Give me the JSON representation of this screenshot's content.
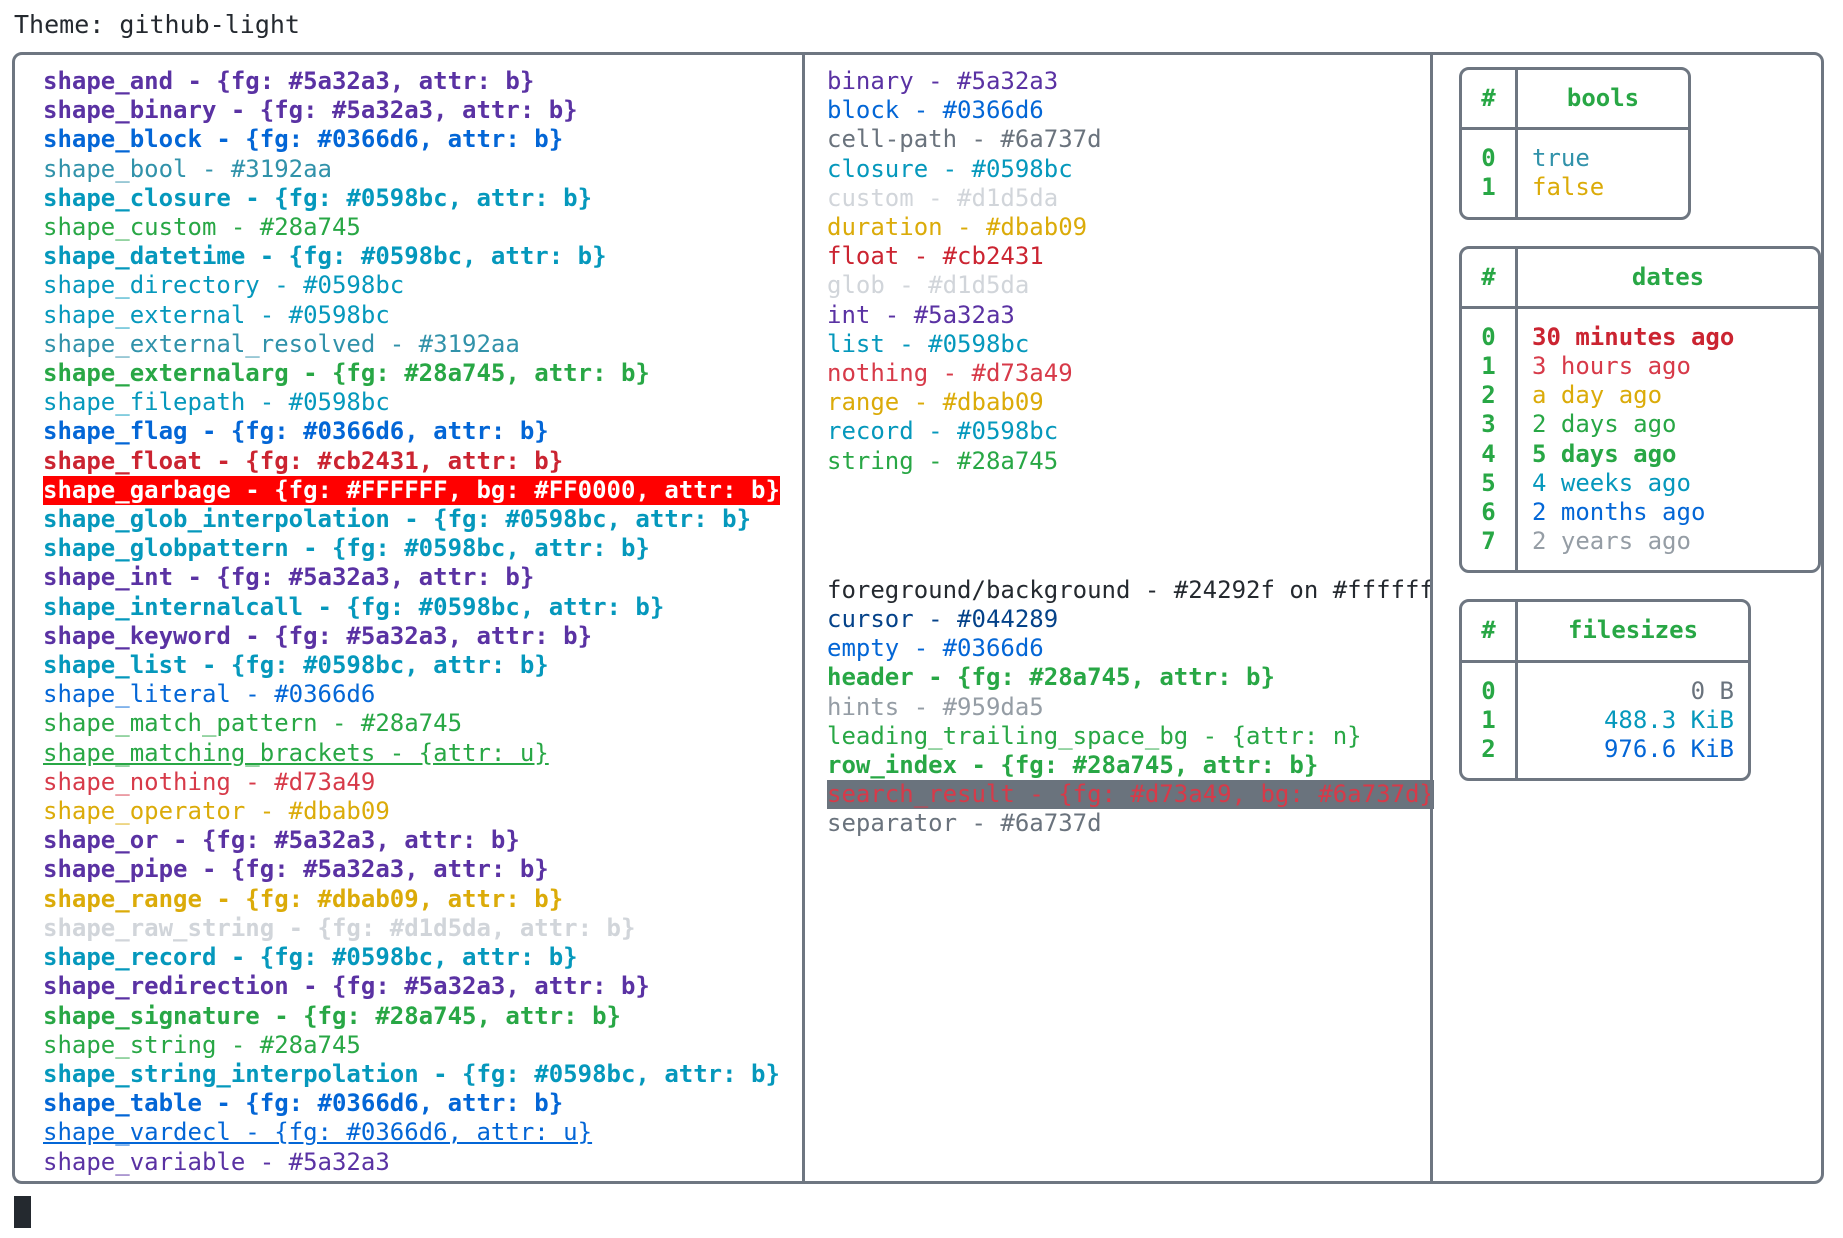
{
  "header": {
    "theme_label": "Theme: github-light"
  },
  "colors": {
    "purple": "#5a32a3",
    "blue": "#0366d6",
    "teal_dark": "#3192aa",
    "cyan": "#0598bc",
    "green": "#28a745",
    "red": "#cb2431",
    "red_alt": "#d73a49",
    "gold": "#dbab09",
    "gray": "#6a737d",
    "gray_light": "#d1d5da",
    "gray_hint": "#959da5",
    "frame": "#6e7681",
    "fg": "#24292f",
    "bg": "#ffffff",
    "garbage_bg": "#FF0000",
    "garbage_fg": "#FFFFFF"
  },
  "shapes": [
    {
      "text": "shape_and - {fg: #5a32a3, attr: b}",
      "color": "#5a32a3",
      "bold": true,
      "underline": false
    },
    {
      "text": "shape_binary - {fg: #5a32a3, attr: b}",
      "color": "#5a32a3",
      "bold": true,
      "underline": false
    },
    {
      "text": "shape_block - {fg: #0366d6, attr: b}",
      "color": "#0366d6",
      "bold": true,
      "underline": false
    },
    {
      "text": "shape_bool - #3192aa",
      "color": "#3192aa",
      "bold": false,
      "underline": false
    },
    {
      "text": "shape_closure - {fg: #0598bc, attr: b}",
      "color": "#0598bc",
      "bold": true,
      "underline": false
    },
    {
      "text": "shape_custom - #28a745",
      "color": "#28a745",
      "bold": false,
      "underline": false
    },
    {
      "text": "shape_datetime - {fg: #0598bc, attr: b}",
      "color": "#0598bc",
      "bold": true,
      "underline": false
    },
    {
      "text": "shape_directory - #0598bc",
      "color": "#0598bc",
      "bold": false,
      "underline": false
    },
    {
      "text": "shape_external - #0598bc",
      "color": "#0598bc",
      "bold": false,
      "underline": false
    },
    {
      "text": "shape_external_resolved - #3192aa",
      "color": "#3192aa",
      "bold": false,
      "underline": false
    },
    {
      "text": "shape_externalarg - {fg: #28a745, attr: b}",
      "color": "#28a745",
      "bold": true,
      "underline": false
    },
    {
      "text": "shape_filepath - #0598bc",
      "color": "#0598bc",
      "bold": false,
      "underline": false
    },
    {
      "text": "shape_flag - {fg: #0366d6, attr: b}",
      "color": "#0366d6",
      "bold": true,
      "underline": false
    },
    {
      "text": "shape_float - {fg: #cb2431, attr: b}",
      "color": "#cb2431",
      "bold": true,
      "underline": false
    },
    {
      "text": "shape_garbage - {fg: #FFFFFF, bg: #FF0000, attr: b}",
      "color": "#FFFFFF",
      "bg": "#FF0000",
      "bold": true,
      "underline": false
    },
    {
      "text": "shape_glob_interpolation - {fg: #0598bc, attr: b}",
      "color": "#0598bc",
      "bold": true,
      "underline": false
    },
    {
      "text": "shape_globpattern - {fg: #0598bc, attr: b}",
      "color": "#0598bc",
      "bold": true,
      "underline": false
    },
    {
      "text": "shape_int - {fg: #5a32a3, attr: b}",
      "color": "#5a32a3",
      "bold": true,
      "underline": false
    },
    {
      "text": "shape_internalcall - {fg: #0598bc, attr: b}",
      "color": "#0598bc",
      "bold": true,
      "underline": false
    },
    {
      "text": "shape_keyword - {fg: #5a32a3, attr: b}",
      "color": "#5a32a3",
      "bold": true,
      "underline": false
    },
    {
      "text": "shape_list - {fg: #0598bc, attr: b}",
      "color": "#0598bc",
      "bold": true,
      "underline": false
    },
    {
      "text": "shape_literal - #0366d6",
      "color": "#0366d6",
      "bold": false,
      "underline": false
    },
    {
      "text": "shape_match_pattern - #28a745",
      "color": "#28a745",
      "bold": false,
      "underline": false
    },
    {
      "text": "shape_matching_brackets - {attr: u}",
      "color": "#28a745",
      "bold": false,
      "underline": true
    },
    {
      "text": "shape_nothing - #d73a49",
      "color": "#d73a49",
      "bold": false,
      "underline": false
    },
    {
      "text": "shape_operator - #dbab09",
      "color": "#dbab09",
      "bold": false,
      "underline": false
    },
    {
      "text": "shape_or - {fg: #5a32a3, attr: b}",
      "color": "#5a32a3",
      "bold": true,
      "underline": false
    },
    {
      "text": "shape_pipe - {fg: #5a32a3, attr: b}",
      "color": "#5a32a3",
      "bold": true,
      "underline": false
    },
    {
      "text": "shape_range - {fg: #dbab09, attr: b}",
      "color": "#dbab09",
      "bold": true,
      "underline": false
    },
    {
      "text": "shape_raw_string - {fg: #d1d5da, attr: b}",
      "color": "#d1d5da",
      "bold": true,
      "underline": false
    },
    {
      "text": "shape_record - {fg: #0598bc, attr: b}",
      "color": "#0598bc",
      "bold": true,
      "underline": false
    },
    {
      "text": "shape_redirection - {fg: #5a32a3, attr: b}",
      "color": "#5a32a3",
      "bold": true,
      "underline": false
    },
    {
      "text": "shape_signature - {fg: #28a745, attr: b}",
      "color": "#28a745",
      "bold": true,
      "underline": false
    },
    {
      "text": "shape_string - #28a745",
      "color": "#28a745",
      "bold": false,
      "underline": false
    },
    {
      "text": "shape_string_interpolation - {fg: #0598bc, attr: b}",
      "color": "#0598bc",
      "bold": true,
      "underline": false
    },
    {
      "text": "shape_table - {fg: #0366d6, attr: b}",
      "color": "#0366d6",
      "bold": true,
      "underline": false
    },
    {
      "text": "shape_vardecl - {fg: #0366d6, attr: u}",
      "color": "#0366d6",
      "bold": false,
      "underline": true
    },
    {
      "text": "shape_variable - #5a32a3",
      "color": "#5a32a3",
      "bold": false,
      "underline": false
    }
  ],
  "types": [
    {
      "text": "binary - #5a32a3",
      "color": "#5a32a3",
      "bold": false,
      "underline": false
    },
    {
      "text": "block - #0366d6",
      "color": "#0366d6",
      "bold": false,
      "underline": false
    },
    {
      "text": "cell-path - #6a737d",
      "color": "#6a737d",
      "bold": false,
      "underline": false
    },
    {
      "text": "closure - #0598bc",
      "color": "#0598bc",
      "bold": false,
      "underline": false
    },
    {
      "text": "custom - #d1d5da",
      "color": "#d1d5da",
      "bold": false,
      "underline": false
    },
    {
      "text": "duration - #dbab09",
      "color": "#dbab09",
      "bold": false,
      "underline": false
    },
    {
      "text": "float - #cb2431",
      "color": "#cb2431",
      "bold": false,
      "underline": false
    },
    {
      "text": "glob - #d1d5da",
      "color": "#d1d5da",
      "bold": false,
      "underline": false
    },
    {
      "text": "int - #5a32a3",
      "color": "#5a32a3",
      "bold": false,
      "underline": false
    },
    {
      "text": "list - #0598bc",
      "color": "#0598bc",
      "bold": false,
      "underline": false
    },
    {
      "text": "nothing - #d73a49",
      "color": "#d73a49",
      "bold": false,
      "underline": false
    },
    {
      "text": "range - #dbab09",
      "color": "#dbab09",
      "bold": false,
      "underline": false
    },
    {
      "text": "record - #0598bc",
      "color": "#0598bc",
      "bold": false,
      "underline": false
    },
    {
      "text": "string - #28a745",
      "color": "#28a745",
      "bold": false,
      "underline": false
    }
  ],
  "ui_elements": [
    {
      "text": "foreground/background - #24292f on #ffffff",
      "color": "#24292f",
      "bold": false,
      "underline": false
    },
    {
      "text": "cursor - #044289",
      "color": "#044289",
      "bold": false,
      "underline": false
    },
    {
      "text": "empty - #0366d6",
      "color": "#0366d6",
      "bold": false,
      "underline": false
    },
    {
      "text": "header - {fg: #28a745, attr: b}",
      "color": "#28a745",
      "bold": true,
      "underline": false
    },
    {
      "text": "hints - #959da5",
      "color": "#959da5",
      "bold": false,
      "underline": false
    },
    {
      "text": "leading_trailing_space_bg - {attr: n}",
      "color": "#28a745",
      "bold": false,
      "underline": false
    },
    {
      "text": "row_index - {fg: #28a745, attr: b}",
      "color": "#28a745",
      "bold": true,
      "underline": false
    },
    {
      "text": "search_result - {fg: #d73a49, bg: #6a737d}",
      "color": "#d73a49",
      "bg": "#6a737d",
      "bold": false,
      "underline": false
    },
    {
      "text": "separator - #6a737d",
      "color": "#6a737d",
      "bold": false,
      "underline": false
    }
  ],
  "tables": [
    {
      "id": "tbl-bools",
      "index_header": "#",
      "value_header": "bools",
      "value_align": "val-left",
      "rows": [
        {
          "index": "0",
          "value": "true",
          "color": "#3192aa",
          "bold": false
        },
        {
          "index": "1",
          "value": "false",
          "color": "#dbab09",
          "bold": false
        }
      ]
    },
    {
      "id": "tbl-dates",
      "index_header": "#",
      "value_header": "dates",
      "value_align": "val-left",
      "rows": [
        {
          "index": "0",
          "value": "30 minutes ago",
          "color": "#cb2431",
          "bold": true
        },
        {
          "index": "1",
          "value": "3 hours ago",
          "color": "#d73a49",
          "bold": false
        },
        {
          "index": "2",
          "value": "a day ago",
          "color": "#dbab09",
          "bold": false
        },
        {
          "index": "3",
          "value": "2 days ago",
          "color": "#28a745",
          "bold": false
        },
        {
          "index": "4",
          "value": "5 days ago",
          "color": "#28a745",
          "bold": true
        },
        {
          "index": "5",
          "value": "4 weeks ago",
          "color": "#0598bc",
          "bold": false
        },
        {
          "index": "6",
          "value": "2 months ago",
          "color": "#0366d6",
          "bold": false
        },
        {
          "index": "7",
          "value": "2 years ago",
          "color": "#959da5",
          "bold": false
        }
      ]
    },
    {
      "id": "tbl-filesizes",
      "index_header": "#",
      "value_header": "filesizes",
      "value_align": "val-right",
      "rows": [
        {
          "index": "0",
          "value": "0 B",
          "color": "#6a737d",
          "bold": false
        },
        {
          "index": "1",
          "value": "488.3 KiB",
          "color": "#0598bc",
          "bold": false
        },
        {
          "index": "2",
          "value": "976.6 KiB",
          "color": "#0366d6",
          "bold": false
        }
      ]
    }
  ],
  "terminal": {
    "cursor": "block-cursor"
  }
}
